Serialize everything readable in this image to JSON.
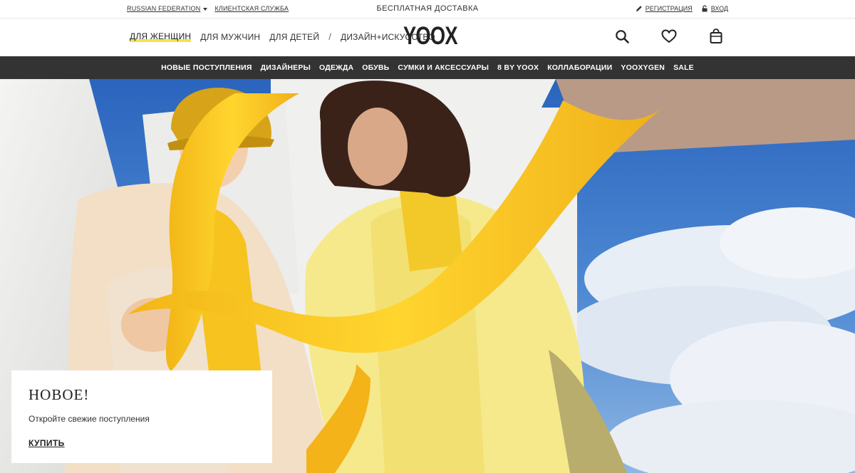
{
  "util_bar": {
    "country": "RUSSIAN FEDERATION",
    "customer_service": "КЛИЕНТСКАЯ СЛУЖБА",
    "free_shipping": "БЕСПЛАТНАЯ ДОСТАВКА",
    "register": "РЕГИСТРАЦИЯ",
    "login": "ВХОД"
  },
  "header": {
    "departments": [
      {
        "label": "ДЛЯ ЖЕНЩИН",
        "active": true
      },
      {
        "label": "ДЛЯ МУЖЧИН",
        "active": false
      },
      {
        "label": "ДЛЯ ДЕТЕЙ",
        "active": false
      },
      {
        "label": "ДИЗАЙН+ИСКУССТВО",
        "active": false
      }
    ],
    "separator": "/",
    "logo": "YOOX",
    "icons": [
      "search-icon",
      "heart-icon",
      "shopping-bag-icon"
    ]
  },
  "categories": [
    "НОВЫЕ ПОСТУПЛЕНИЯ",
    "ДИЗАЙНЕРЫ",
    "ОДЕЖДА",
    "ОБУВЬ",
    "СУМКИ И АКСЕССУАРЫ",
    "8 BY YOOX",
    "КОЛЛАБОРАЦИИ",
    "YOOXYGEN",
    "SALE"
  ],
  "promo": {
    "title": "НОВОЕ!",
    "subtitle": "Откройте свежие поступления",
    "cta": "КУПИТЬ"
  },
  "colors": {
    "accent_yellow": "#f5e44a",
    "nav_background": "#333333",
    "sky_blue": "#2f6fc4"
  }
}
